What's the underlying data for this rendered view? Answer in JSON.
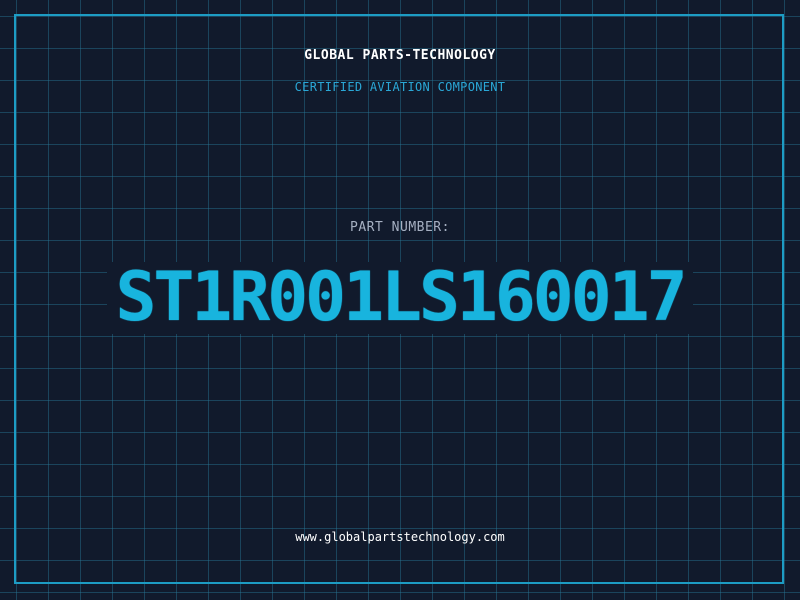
{
  "header": {
    "company_name": "GLOBAL PARTS-TECHNOLOGY",
    "tagline": "CERTIFIED AVIATION COMPONENT"
  },
  "part": {
    "label": "PART NUMBER:",
    "number": "ST1R001LS160017"
  },
  "footer": {
    "website": "www.globalpartstechnology.com"
  },
  "colors": {
    "background": "#111a2c",
    "grid": "#28788f",
    "frame": "#1d9cc4",
    "accent": "#18b4de",
    "label": "#a6b0c2",
    "text": "#ffffff"
  }
}
